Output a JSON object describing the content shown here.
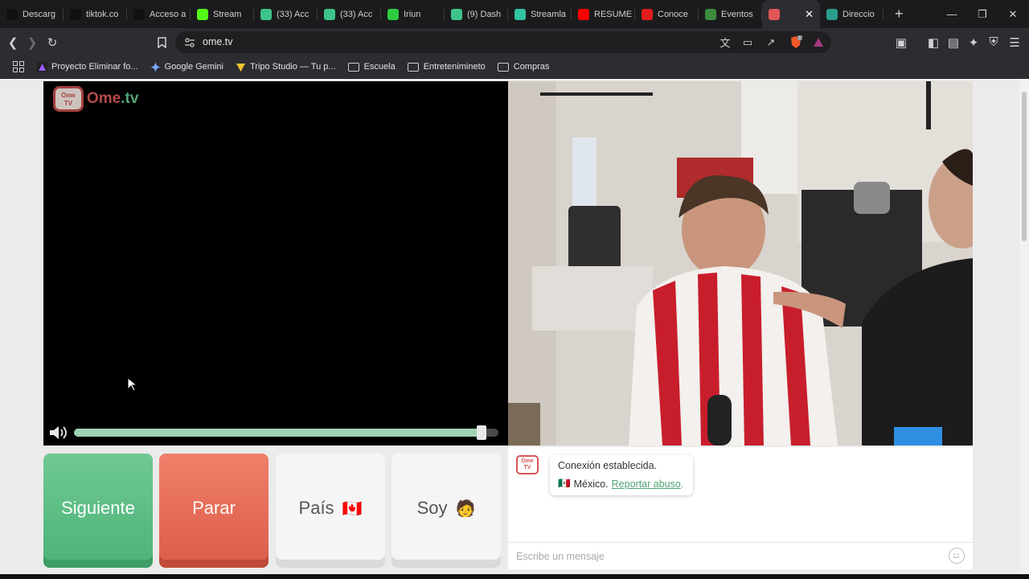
{
  "browser": {
    "tabs": [
      {
        "title": "Descarg",
        "icon": "tiktok-icon",
        "color": "#111"
      },
      {
        "title": "tiktok.co",
        "icon": "tiktok-icon",
        "color": "#111"
      },
      {
        "title": "Acceso a",
        "icon": "tiktok-icon",
        "color": "#111"
      },
      {
        "title": "Stream",
        "icon": "kick-icon",
        "color": "#53fc18"
      },
      {
        "title": "(33) Acc",
        "icon": "app-icon",
        "color": "#3ec48b"
      },
      {
        "title": "(33) Acc",
        "icon": "app-icon",
        "color": "#3ec48b"
      },
      {
        "title": "Iriun",
        "icon": "dot-icon",
        "color": "#2ecc40"
      },
      {
        "title": "(9) Dash",
        "icon": "app-icon",
        "color": "#3ec48b"
      },
      {
        "title": "Streamla",
        "icon": "streamlabs-icon",
        "color": "#31c3a2"
      },
      {
        "title": "RESUME",
        "icon": "youtube-icon",
        "color": "#ff0000"
      },
      {
        "title": "Conoce",
        "icon": "brand-icon",
        "color": "#e21b1b"
      },
      {
        "title": "Eventos",
        "icon": "soccer-icon",
        "color": "#3c8a3c"
      },
      {
        "title": "",
        "icon": "ometv-icon",
        "color": "#e05656",
        "active": true
      },
      {
        "title": "Direccio",
        "icon": "globe-icon",
        "color": "#2a9d8f"
      }
    ],
    "new_tab": "+",
    "url": "ome.tv",
    "bookmarks": [
      {
        "label": "Proyecto Eliminar fo...",
        "icon": "triangle-icon"
      },
      {
        "label": "Google Gemini",
        "icon": "gemini-icon"
      },
      {
        "label": "Tripo Studio — Tu p...",
        "icon": "tripo-icon"
      },
      {
        "label": "Escuela",
        "icon": "folder-icon"
      },
      {
        "label": "Entretenimineto",
        "icon": "folder-icon"
      },
      {
        "label": "Compras",
        "icon": "folder-icon"
      }
    ],
    "brave_badge": "2"
  },
  "app": {
    "logo": {
      "ome": "Ome",
      "dot_tv": ".tv",
      "badge_top": "Ome",
      "badge_bottom": "TV"
    },
    "volume": 0.96,
    "buttons": {
      "next": "Siguiente",
      "stop": "Parar",
      "country": "País",
      "country_flag": "🇨🇦",
      "gender": "Soy",
      "gender_emoji": "🧑"
    },
    "chat": {
      "connected": "Conexión establecida.",
      "country_flag": "🇲🇽",
      "country": "México.",
      "report_link": "Reportar abuso",
      "report_suffix": ".",
      "placeholder": "Escribe un mensaje"
    }
  }
}
